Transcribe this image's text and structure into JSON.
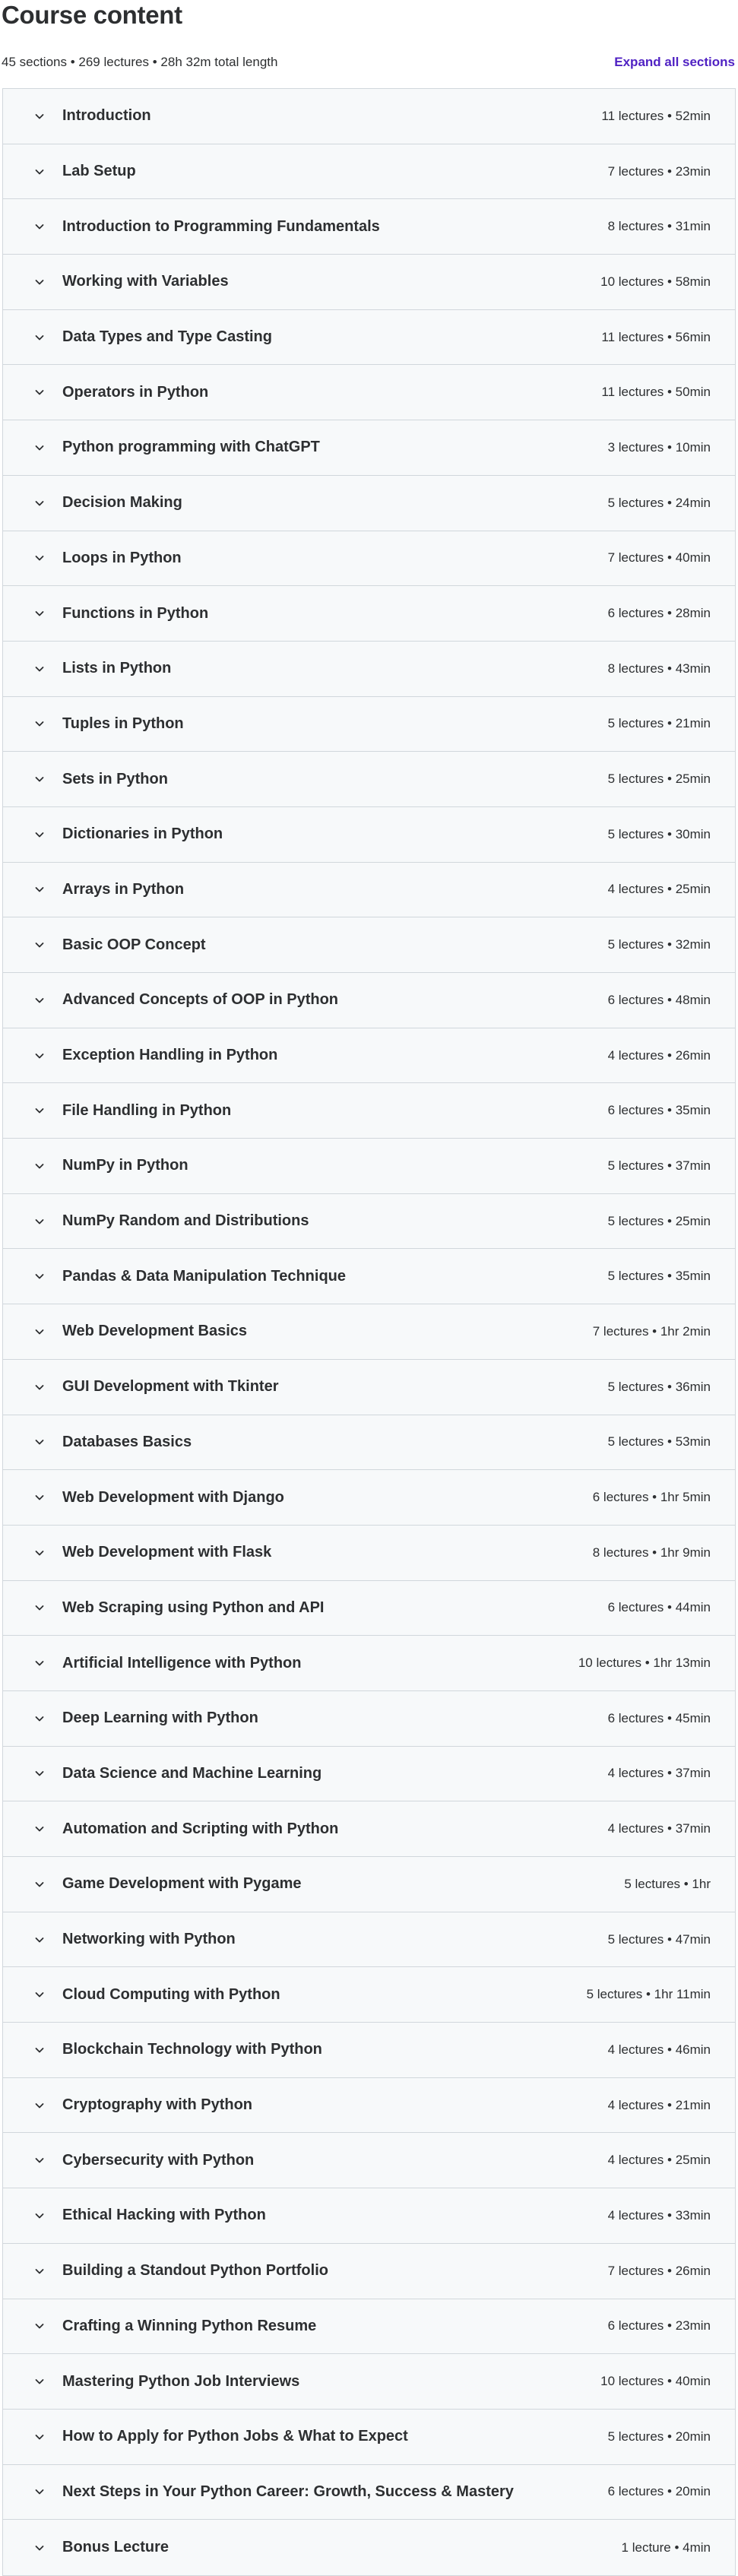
{
  "header": {
    "title": "Course content"
  },
  "summary": {
    "text": "45 sections • 269 lectures • 28h 32m total length",
    "expand_label": "Expand all sections"
  },
  "icons": {
    "section_toggle": "chevron-down-icon"
  },
  "colors": {
    "accent": "#5022c3",
    "row_background": "#f7f9fa",
    "border": "#d1d7dc",
    "text": "#2d2f31"
  },
  "sections": [
    {
      "title": "Introduction",
      "meta": "11 lectures • 52min"
    },
    {
      "title": "Lab Setup",
      "meta": "7 lectures • 23min"
    },
    {
      "title": "Introduction to Programming Fundamentals",
      "meta": "8 lectures • 31min"
    },
    {
      "title": "Working with Variables",
      "meta": "10 lectures • 58min"
    },
    {
      "title": "Data Types and Type Casting",
      "meta": "11 lectures • 56min"
    },
    {
      "title": "Operators in Python",
      "meta": "11 lectures • 50min"
    },
    {
      "title": "Python programming with ChatGPT",
      "meta": "3 lectures • 10min"
    },
    {
      "title": "Decision Making",
      "meta": "5 lectures • 24min"
    },
    {
      "title": "Loops in Python",
      "meta": "7 lectures • 40min"
    },
    {
      "title": "Functions in Python",
      "meta": "6 lectures • 28min"
    },
    {
      "title": "Lists in Python",
      "meta": "8 lectures • 43min"
    },
    {
      "title": "Tuples in Python",
      "meta": "5 lectures • 21min"
    },
    {
      "title": "Sets in Python",
      "meta": "5 lectures • 25min"
    },
    {
      "title": "Dictionaries in Python",
      "meta": "5 lectures • 30min"
    },
    {
      "title": "Arrays in Python",
      "meta": "4 lectures • 25min"
    },
    {
      "title": "Basic OOP Concept",
      "meta": "5 lectures • 32min"
    },
    {
      "title": "Advanced Concepts of OOP in Python",
      "meta": "6 lectures • 48min"
    },
    {
      "title": "Exception Handling in Python",
      "meta": "4 lectures • 26min"
    },
    {
      "title": "File Handling in Python",
      "meta": "6 lectures • 35min"
    },
    {
      "title": "NumPy in Python",
      "meta": "5 lectures • 37min"
    },
    {
      "title": "NumPy Random and Distributions",
      "meta": "5 lectures • 25min"
    },
    {
      "title": "Pandas & Data Manipulation Technique",
      "meta": "5 lectures • 35min"
    },
    {
      "title": "Web Development Basics",
      "meta": "7 lectures • 1hr 2min"
    },
    {
      "title": "GUI Development with Tkinter",
      "meta": "5 lectures • 36min"
    },
    {
      "title": "Databases Basics",
      "meta": "5 lectures • 53min"
    },
    {
      "title": "Web Development with Django",
      "meta": "6 lectures • 1hr 5min"
    },
    {
      "title": "Web Development with Flask",
      "meta": "8 lectures • 1hr 9min"
    },
    {
      "title": "Web Scraping using Python and API",
      "meta": "6 lectures • 44min"
    },
    {
      "title": "Artificial Intelligence with Python",
      "meta": "10 lectures • 1hr 13min"
    },
    {
      "title": "Deep Learning with Python",
      "meta": "6 lectures • 45min"
    },
    {
      "title": "Data Science and Machine Learning",
      "meta": "4 lectures • 37min"
    },
    {
      "title": "Automation and Scripting with Python",
      "meta": "4 lectures • 37min"
    },
    {
      "title": "Game Development with Pygame",
      "meta": "5 lectures • 1hr"
    },
    {
      "title": "Networking with Python",
      "meta": "5 lectures • 47min"
    },
    {
      "title": "Cloud Computing with Python",
      "meta": "5 lectures • 1hr 11min"
    },
    {
      "title": "Blockchain Technology with Python",
      "meta": "4 lectures • 46min"
    },
    {
      "title": "Cryptography with Python",
      "meta": "4 lectures • 21min"
    },
    {
      "title": "Cybersecurity with Python",
      "meta": "4 lectures • 25min"
    },
    {
      "title": "Ethical Hacking with Python",
      "meta": "4 lectures • 33min"
    },
    {
      "title": "Building a Standout Python Portfolio",
      "meta": "7 lectures • 26min"
    },
    {
      "title": "Crafting a Winning Python Resume",
      "meta": "6 lectures • 23min"
    },
    {
      "title": "Mastering Python Job Interviews",
      "meta": "10 lectures • 40min"
    },
    {
      "title": "How to Apply for Python Jobs & What to Expect",
      "meta": "5 lectures • 20min"
    },
    {
      "title": "Next Steps in Your Python Career: Growth, Success & Mastery",
      "meta": "6 lectures • 20min"
    },
    {
      "title": "Bonus Lecture",
      "meta": "1 lecture • 4min"
    }
  ]
}
